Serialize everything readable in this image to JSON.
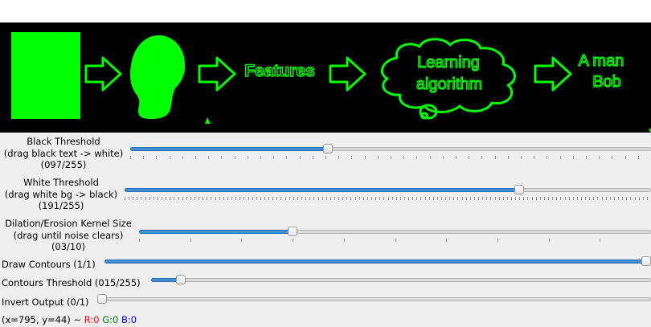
{
  "image": {
    "words": {
      "features": "Features",
      "cloud_line1": "Learning",
      "cloud_line2": "algorithm",
      "result_line1": "A man",
      "result_line2": "Bob"
    },
    "fg_color": "#00ff00",
    "bg_color": "#000000"
  },
  "trackbars": [
    {
      "lines": [
        "Black Threshold",
        "(drag black text -> white)",
        "(097/255)"
      ],
      "value": 97,
      "max": 255
    },
    {
      "lines": [
        "White Threshold",
        "(drag white bg -> black)",
        "(191/255)"
      ],
      "value": 191,
      "max": 255
    },
    {
      "lines": [
        "Dilation/Erosion Kernel Size",
        "(drag until noise clears)",
        "(03/10)"
      ],
      "value": 3,
      "max": 10
    },
    {
      "lines": [
        "Draw Contours (1/1)"
      ],
      "value": 1,
      "max": 1
    },
    {
      "lines": [
        "Contours Threshold (015/255)"
      ],
      "value": 15,
      "max": 255
    },
    {
      "lines": [
        "Invert Output (0/1)"
      ],
      "value": 0,
      "max": 1
    }
  ],
  "status": {
    "coords": "(x=795, y=44) ~",
    "r": "R:0",
    "g": "G:0",
    "b": "B:0",
    "r_color": "#ff0000",
    "g_color": "#008000",
    "b_color": "#0000ff"
  },
  "accent_color": "#3f8ed6"
}
